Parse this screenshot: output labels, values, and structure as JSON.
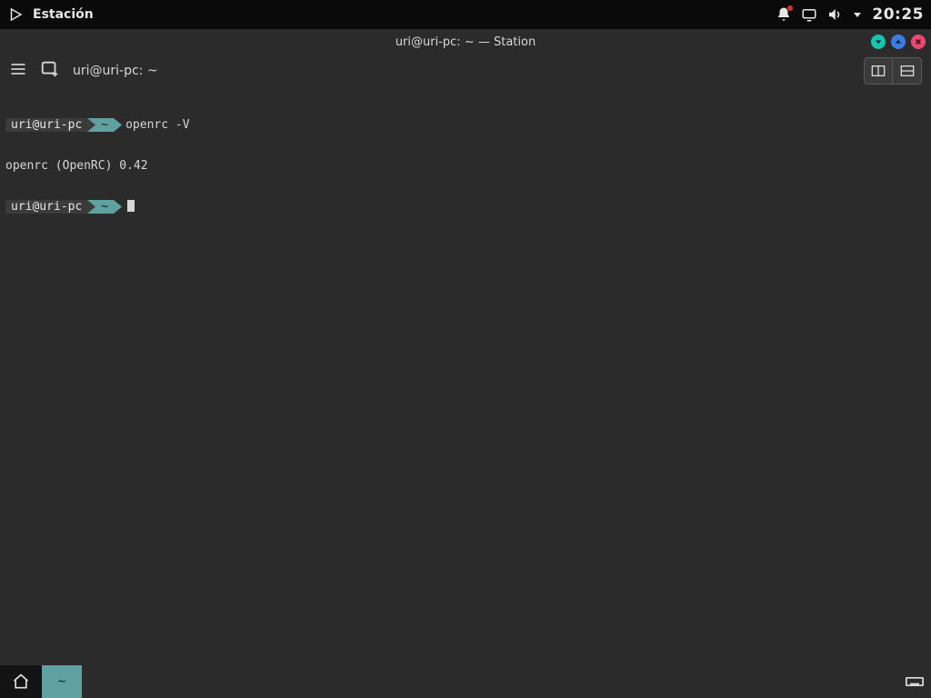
{
  "panel": {
    "app_name": "Estación",
    "clock": "20:25"
  },
  "window": {
    "title": "uri@uri-pc: ~ — Station",
    "tab_title": "uri@uri-pc: ~"
  },
  "terminal": {
    "prompt_user": "uri@uri-pc",
    "prompt_path": "~",
    "lines": {
      "cmd1": "openrc -V",
      "out1": "openrc (OpenRC) 0.42"
    }
  },
  "taskbar": {
    "tab_label": "~"
  },
  "icons": {
    "panel_play": "play-icon",
    "bell": "bell-icon",
    "display": "display-icon",
    "volume": "volume-icon",
    "dropdown": "chevron-down-icon",
    "hamburger": "hamburger-icon",
    "new_tab": "new-tab-icon",
    "split_v": "split-vertical-icon",
    "split_h": "split-horizontal-icon",
    "home": "home-icon",
    "keyboard": "keyboard-icon",
    "minimize": "minimize-icon",
    "maximize": "maximize-icon",
    "close": "close-icon"
  },
  "colors": {
    "accent_teal": "#5fa0a0",
    "bg_dark": "#0a0a0a",
    "bg_window": "#2b2b2b",
    "btn_min": "#19c3b2",
    "btn_max": "#3b7de0",
    "btn_close": "#e84a6f"
  }
}
